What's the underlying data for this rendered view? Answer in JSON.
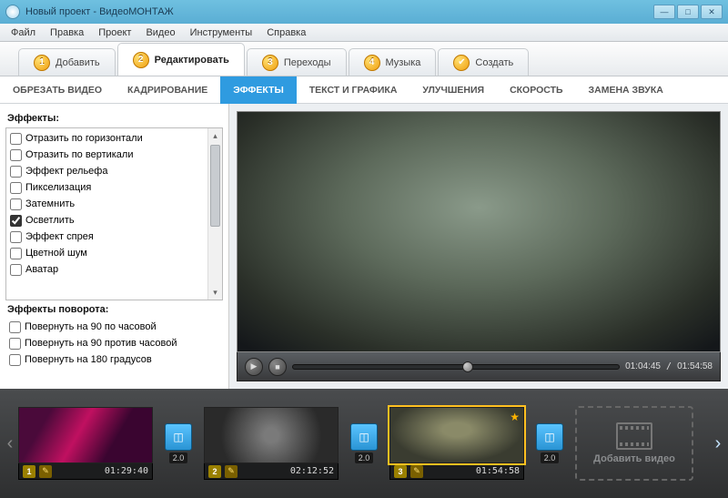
{
  "window": {
    "title": "Новый проект - ВидеоМОНТАЖ"
  },
  "menu": [
    "Файл",
    "Правка",
    "Проект",
    "Видео",
    "Инструменты",
    "Справка"
  ],
  "steps": [
    {
      "num": "1",
      "label": "Добавить"
    },
    {
      "num": "2",
      "label": "Редактировать"
    },
    {
      "num": "3",
      "label": "Переходы"
    },
    {
      "num": "4",
      "label": "Музыка"
    },
    {
      "num": "✔",
      "label": "Создать"
    }
  ],
  "subtabs": [
    "ОБРЕЗАТЬ ВИДЕО",
    "КАДРИРОВАНИЕ",
    "ЭФФЕКТЫ",
    "ТЕКСТ И ГРАФИКА",
    "УЛУЧШЕНИЯ",
    "СКОРОСТЬ",
    "ЗАМЕНА ЗВУКА"
  ],
  "effects": {
    "title": "Эффекты:",
    "items": [
      {
        "label": "Отразить по горизонтали",
        "checked": false
      },
      {
        "label": "Отразить по вертикали",
        "checked": false
      },
      {
        "label": "Эффект рельефа",
        "checked": false
      },
      {
        "label": "Пикселизация",
        "checked": false
      },
      {
        "label": "Затемнить",
        "checked": false
      },
      {
        "label": "Осветлить",
        "checked": true
      },
      {
        "label": "Эффект спрея",
        "checked": false
      },
      {
        "label": "Цветной шум",
        "checked": false
      },
      {
        "label": "Аватар",
        "checked": false
      }
    ],
    "rotate_title": "Эффекты поворота:",
    "rotate": [
      {
        "label": "Повернуть на 90 по часовой"
      },
      {
        "label": "Повернуть на 90 против часовой"
      },
      {
        "label": "Повернуть на 180 градусов"
      }
    ]
  },
  "player": {
    "current": "01:04:45",
    "total": "01:54:58"
  },
  "clips": [
    {
      "num": "1",
      "dur": "01:29:40"
    },
    {
      "num": "2",
      "dur": "02:12:52"
    },
    {
      "num": "3",
      "dur": "01:54:58"
    }
  ],
  "transition_len": "2.0",
  "add_video": "Добавить видео"
}
